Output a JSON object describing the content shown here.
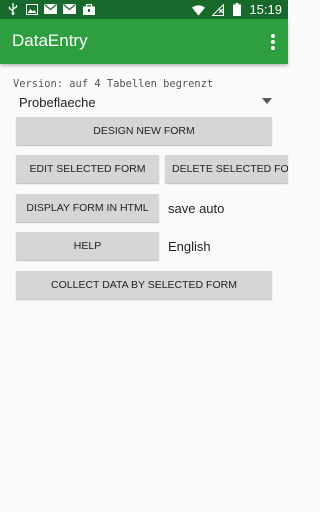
{
  "status_bar": {
    "time": "15:19",
    "left_icons": [
      "usb-icon",
      "image-icon",
      "mail-icon",
      "mail-icon",
      "briefcase-icon"
    ],
    "right_icons": [
      "wifi-icon",
      "no-signal-icon",
      "battery-icon"
    ]
  },
  "app_bar": {
    "title": "DataEntry",
    "menu_icon": "overflow-menu-icon"
  },
  "version_text": "Version: auf 4 Tabellen begrenzt",
  "spinner": {
    "selected": "Probeflaeche"
  },
  "buttons": {
    "design_new_form": "DESIGN NEW FORM",
    "edit_selected_form": "EDIT SELECTED FORM",
    "delete_selected_form": "DELETE SELECTED FORM",
    "display_form_html": "DISPLAY FORM IN HTML",
    "help": "HELP",
    "collect_data": "COLLECT DATA BY SELECTED FORM"
  },
  "labels": {
    "save_mode": "save auto",
    "language": "English"
  },
  "colors": {
    "status_bar": "#17692b",
    "app_bar": "#2e9f3f",
    "button": "#d6d6d6",
    "background": "#fafafa"
  }
}
